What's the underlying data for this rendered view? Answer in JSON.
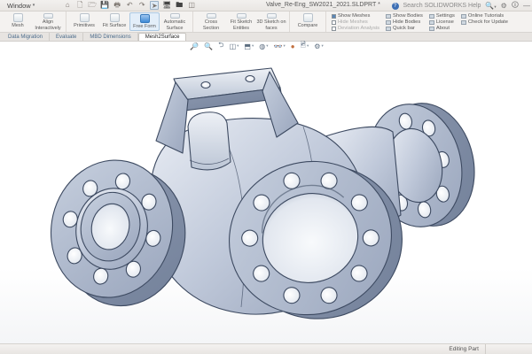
{
  "titlebar": {
    "menu_label": "Window",
    "filename": "Valve_Re-Eng_SW2021_2021.SLDPRT *",
    "help_search": "Search SOLIDWORKS Help",
    "minimize_glyph": "—"
  },
  "ribbon": {
    "groups": [
      {
        "buttons": [
          {
            "label": "Mesh"
          },
          {
            "label": "Align Interactively"
          }
        ]
      },
      {
        "buttons": [
          {
            "label": "Primitives"
          },
          {
            "label": "Fit Surface"
          },
          {
            "label": "Free Form"
          },
          {
            "label": "Automatic Surface"
          }
        ]
      },
      {
        "buttons": [
          {
            "label": "Cross Section"
          },
          {
            "label": "Fit Sketch Entities"
          },
          {
            "label": "3D Sketch on faces"
          }
        ]
      },
      {
        "buttons": [
          {
            "label": "Compare"
          }
        ]
      }
    ],
    "toggles": {
      "col1": [
        "Show Meshes",
        "Hide Meshes",
        "Deviation Analysis"
      ],
      "col2": [
        "Show Bodies",
        "Hide Bodies",
        "Quick bar"
      ],
      "col3": [
        "Settings",
        "License",
        "About"
      ],
      "col4": [
        "Online Tutorials",
        "Check for Update"
      ]
    }
  },
  "tabs": [
    {
      "label": "Data Migration"
    },
    {
      "label": "Evaluate"
    },
    {
      "label": "MBD Dimensions"
    },
    {
      "label": "Mesh2Surface"
    }
  ],
  "viewport": {
    "model_name": "valve-body-4-way-flanged",
    "headsup_icons": [
      "zoom-to-fit",
      "zoom-to-area",
      "previous-view",
      "section-view",
      "view-orientation",
      "display-style",
      "hide-show-items",
      "edit-appearance",
      "apply-scene",
      "view-settings"
    ]
  },
  "statusbar": {
    "mode": "Editing Part"
  },
  "colors": {
    "accent_blue": "#3f8ad6",
    "model_outline": "#3d4a61",
    "model_face": "#a9b4c8",
    "model_light": "#e8ecf3"
  }
}
